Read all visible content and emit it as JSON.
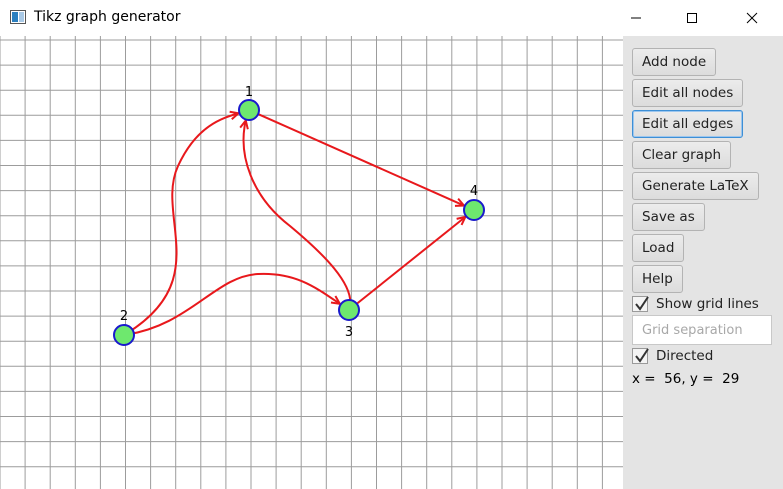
{
  "window": {
    "title": "Tikz graph generator"
  },
  "graph": {
    "directed": true,
    "nodes": [
      {
        "label": "1"
      },
      {
        "label": "2"
      },
      {
        "label": "3"
      },
      {
        "label": "4"
      }
    ],
    "edges": [
      {
        "from": "1",
        "to": "4"
      },
      {
        "from": "2",
        "to": "1"
      },
      {
        "from": "2",
        "to": "3"
      },
      {
        "from": "3",
        "to": "1"
      },
      {
        "from": "3",
        "to": "4"
      }
    ],
    "colors": {
      "node_fill": "#6ee86e",
      "node_stroke": "#1a1acc",
      "edge": "#e8181c",
      "grid": "#9c9c9c"
    }
  },
  "sidebar": {
    "buttons": {
      "add_node": "Add node",
      "edit_all_nodes": "Edit all nodes",
      "edit_all_edges": "Edit all edges",
      "clear_graph": "Clear graph",
      "generate_latex": "Generate LaTeX",
      "save_as": "Save as",
      "load": "Load",
      "help": "Help"
    },
    "show_grid_lines": {
      "label": "Show grid lines",
      "checked": true
    },
    "grid_separation": {
      "placeholder": "Grid separation",
      "value": ""
    },
    "directed": {
      "label": "Directed",
      "checked": true
    },
    "coords_text": "x =  56, y =  29"
  }
}
